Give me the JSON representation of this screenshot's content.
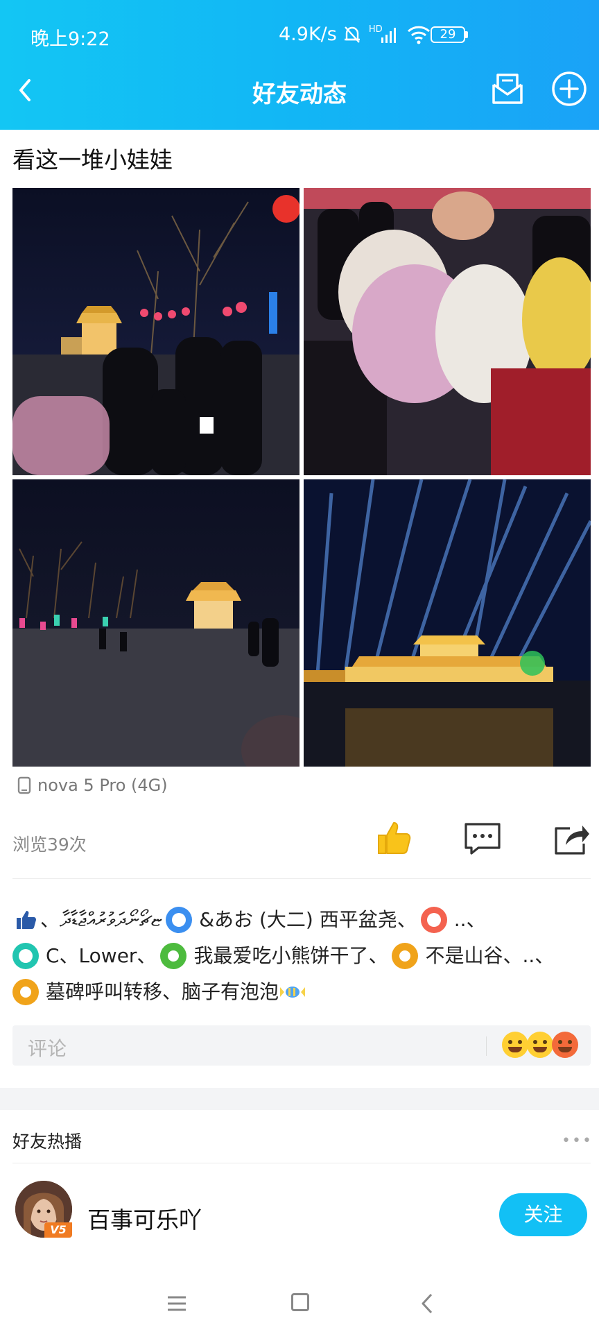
{
  "status_bar": {
    "time": "晚上9:22",
    "net_speed": "4.9K/s",
    "hd_label": "HD",
    "battery": "29"
  },
  "nav": {
    "title": "好友动态"
  },
  "post": {
    "title": "看这一堆小娃娃",
    "device": "nova 5 Pro (4G)",
    "views": "浏览39次"
  },
  "likes": {
    "segments": [
      "、ޏޗޯނޯދަވުރުއްޖާޑާދާ",
      "&あお (大二) 西平盆尧、",
      "..、",
      "C、Lower、",
      "我最爱吃小熊饼干了、",
      "不是山谷、..、",
      "墓碑呼叫转移、脑子有泡泡"
    ]
  },
  "comment": {
    "placeholder": "评论"
  },
  "hot": {
    "section_title": "好友热播",
    "more": "•••",
    "user_name": "百事可乐吖",
    "vip_badge": "V5",
    "follow_label": "关注"
  },
  "colors": {
    "header_start": "#13c6f4",
    "header_end": "#1aa2f7",
    "accent": "#12c0f5",
    "like_yellow": "#f9c31a"
  }
}
